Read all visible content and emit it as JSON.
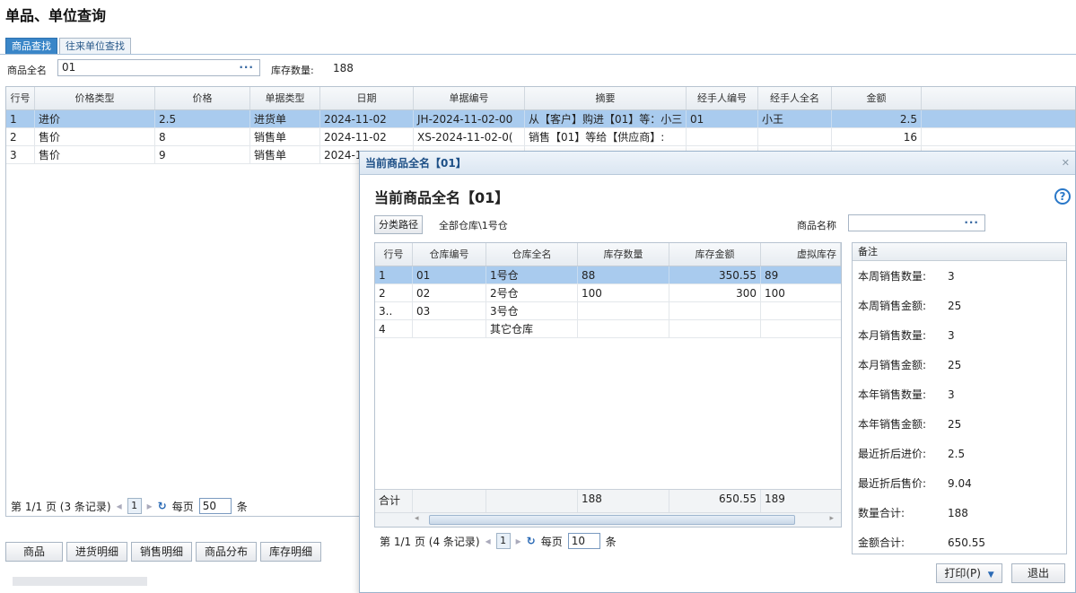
{
  "page": {
    "title": "单品、单位查询"
  },
  "tabs": [
    {
      "label": "商品查找",
      "active": true
    },
    {
      "label": "往来单位查找",
      "active": false
    }
  ],
  "filter": {
    "name_label": "商品全名",
    "name_value": "01",
    "stock_label": "库存数量:",
    "stock_value": "188"
  },
  "main_grid": {
    "columns": [
      "行号",
      "价格类型",
      "价格",
      "单据类型",
      "日期",
      "单据编号",
      "摘要",
      "经手人编号",
      "经手人全名",
      "金额"
    ],
    "rows": [
      [
        "1",
        "进价",
        "2.5",
        "进货单",
        "2024-11-02",
        "JH-2024-11-02-00",
        "从【客户】购进【01】等：小三",
        "01",
        "小王",
        "2.5"
      ],
      [
        "2",
        "售价",
        "8",
        "销售单",
        "2024-11-02",
        "XS-2024-11-02-0(",
        "销售【01】等给【供应商】:",
        "",
        "",
        "16"
      ],
      [
        "3",
        "售价",
        "9",
        "销售单",
        "2024-1",
        "",
        "",
        "",
        "",
        ""
      ]
    ],
    "selected_row": 0
  },
  "main_pager": {
    "info": "第 1/1 页 (3 条记录)",
    "page": "1",
    "per_page_label": "每页",
    "per_page": "50",
    "unit": "条"
  },
  "bottom_buttons": [
    "商品",
    "进货明细",
    "销售明细",
    "商品分布",
    "库存明细"
  ],
  "dialog": {
    "title_bar": "当前商品全名【01】",
    "heading": "当前商品全名【01】",
    "path_button": "分类路径",
    "path_value": "全部仓库\\1号仓",
    "product_name_label": "商品名称",
    "grid": {
      "columns": [
        "行号",
        "仓库编号",
        "仓库全名",
        "库存数量",
        "库存金额",
        "虚拟库存"
      ],
      "rows": [
        [
          "1",
          "01",
          "1号仓",
          "88",
          "350.55",
          "89"
        ],
        [
          "2",
          "02",
          "2号仓",
          "100",
          "300",
          "100"
        ],
        [
          "3..",
          "03",
          "3号仓",
          "",
          "",
          ""
        ],
        [
          "4",
          "",
          "其它仓库",
          "",
          "",
          ""
        ]
      ],
      "selected_row": 0,
      "total": [
        "合计",
        "",
        "",
        "188",
        "650.55",
        "189"
      ]
    },
    "pager": {
      "info": "第 1/1 页 (4 条记录)",
      "page": "1",
      "per_page_label": "每页",
      "per_page": "10",
      "unit": "条"
    },
    "side_panel": {
      "header": "备注",
      "items": [
        {
          "k": "本周销售数量:",
          "v": "3"
        },
        {
          "k": "本周销售金额:",
          "v": "25"
        },
        {
          "k": "本月销售数量:",
          "v": "3"
        },
        {
          "k": "本月销售金额:",
          "v": "25"
        },
        {
          "k": "本年销售数量:",
          "v": "3"
        },
        {
          "k": "本年销售金额:",
          "v": "25"
        },
        {
          "k": "最近折后进价:",
          "v": "2.5"
        },
        {
          "k": "最近折后售价:",
          "v": "9.04"
        },
        {
          "k": "数量合计:",
          "v": "188"
        },
        {
          "k": "金额合计:",
          "v": "650.55"
        }
      ]
    },
    "print_button": "打印(P)",
    "exit_button": "退出"
  }
}
